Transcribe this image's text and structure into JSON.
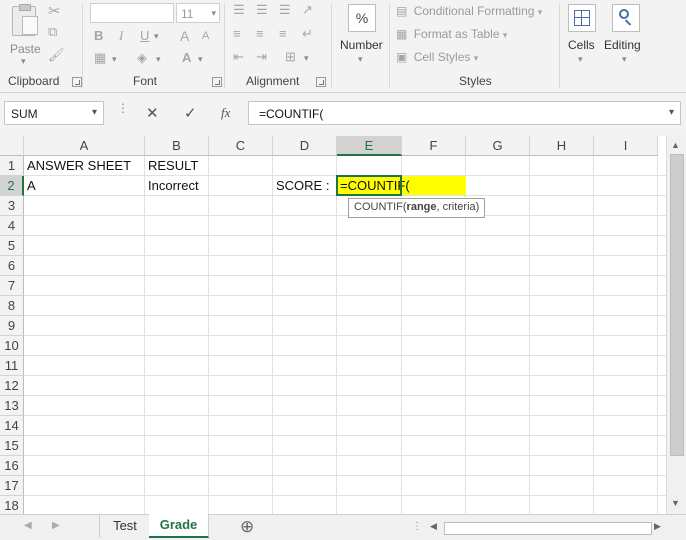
{
  "ribbon": {
    "clipboard": {
      "paste_label": "Paste",
      "group_label": "Clipboard"
    },
    "font": {
      "font_name": "",
      "font_size": "11",
      "group_label": "Font",
      "bold": "B",
      "italic": "I",
      "underline": "U",
      "grow": "A",
      "shrink": "A"
    },
    "alignment": {
      "group_label": "Alignment"
    },
    "number": {
      "percent": "%",
      "label": "Number"
    },
    "styles": {
      "conditional_formatting": "Conditional Formatting",
      "format_as_table": "Format as Table",
      "cell_styles": "Cell Styles",
      "group_label": "Styles"
    },
    "cells": {
      "label": "Cells"
    },
    "editing": {
      "label": "Editing"
    }
  },
  "formula_bar": {
    "name_box": "SUM",
    "cancel": "✕",
    "enter": "✓",
    "fx": "fx",
    "formula": "=COUNTIF("
  },
  "columns": [
    "A",
    "B",
    "C",
    "D",
    "E",
    "F",
    "G",
    "H",
    "I"
  ],
  "rows": [
    "1",
    "2",
    "3",
    "4",
    "5",
    "6",
    "7",
    "8",
    "9",
    "10",
    "11",
    "12",
    "13",
    "14",
    "15",
    "16",
    "17",
    "18"
  ],
  "cells": {
    "A1": "ANSWER SHEET",
    "B1": "RESULT",
    "A2": "A",
    "B2": "Incorrect",
    "D2": "SCORE :",
    "E2": "=COUNTIF("
  },
  "tooltip": {
    "fn": "COUNTIF(",
    "arg1": "range",
    "rest": ", criteria)"
  },
  "sheets": {
    "tab1": "Test",
    "tab2": "Grade",
    "add": "⊕"
  },
  "colors": {
    "active_cell_fill": "#ffff00",
    "selection_green": "#217346",
    "accent": "#217346"
  }
}
